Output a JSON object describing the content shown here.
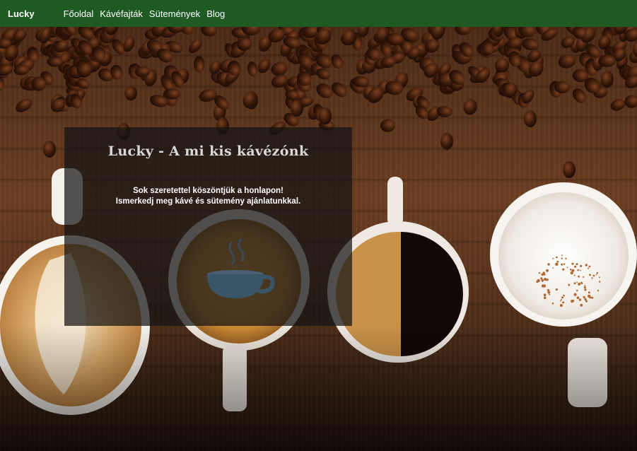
{
  "nav": {
    "brand": "Lucky",
    "links": [
      "Főoldal",
      "Kávéfajták",
      "Sütemények",
      "Blog"
    ]
  },
  "hero": {
    "title": "Lucky - A mi kis kávézónk",
    "lines": [
      "Sok szeretettel köszöntjük a honlapon!",
      "Ismerkedj meg kávé és sütemény ajánlatunkkal."
    ]
  },
  "colors": {
    "navbar": "#1f5a23",
    "overlay": "rgba(20,20,20,0.72)"
  }
}
